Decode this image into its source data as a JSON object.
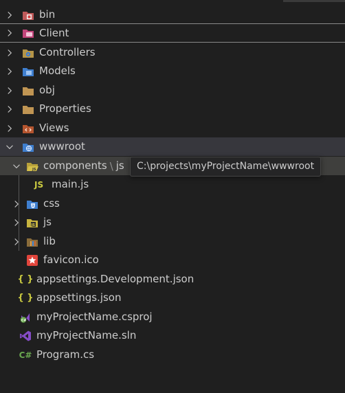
{
  "explorer": {
    "items": [
      {
        "label": "bin"
      },
      {
        "label": "Client"
      },
      {
        "label": "Controllers"
      },
      {
        "label": "Models"
      },
      {
        "label": "obj"
      },
      {
        "label": "Properties"
      },
      {
        "label": "Views"
      },
      {
        "label": "wwwroot"
      },
      {
        "label": "components",
        "separator": "\\",
        "suffix": "js"
      },
      {
        "label": "main.js"
      },
      {
        "label": "css"
      },
      {
        "label": "js"
      },
      {
        "label": "lib"
      },
      {
        "label": "favicon.ico"
      },
      {
        "label": "appsettings.Development.json"
      },
      {
        "label": "appsettings.json"
      },
      {
        "label": "myProjectName.csproj"
      },
      {
        "label": "myProjectName.sln"
      },
      {
        "label": "Program.cs"
      }
    ],
    "js_badge": "JS",
    "json_badge": "{ }",
    "cs_badge": "C#"
  },
  "tooltip": {
    "text": "C:\\projects\\myProjectName\\wwwroot"
  },
  "colors": {
    "background": "#1f1f1f",
    "folder": "#c09553",
    "js_yellow": "#cbcb41",
    "css_blue": "#4285f4",
    "cs_green": "#6aa84f",
    "vs_purple": "#854cc7"
  }
}
